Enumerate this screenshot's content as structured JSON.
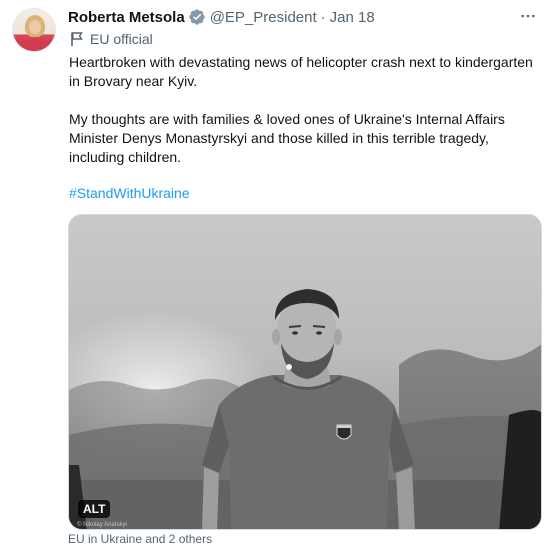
{
  "tweet": {
    "author_name": "Roberta Metsola",
    "handle": "@EP_President",
    "separator": "·",
    "date": "Jan 18",
    "more_label": "···",
    "affiliation": "EU official",
    "paragraphs": [
      "Heartbroken with devastating news of helicopter crash next to kindergarten in Brovary near Kyiv.",
      "My thoughts are with families & loved ones of Ukraine's Internal Affairs Minister Denys Monastyrskyi and those killed in this terrible tragedy, including children."
    ],
    "hashtag": "#StandWithUkraine",
    "media": {
      "alt_label": "ALT",
      "photo_credit": "© Nikolay Anatskyi"
    },
    "tagged": "EU in Ukraine and 2 others"
  },
  "colors": {
    "text": "#0f1419",
    "secondary": "#536471",
    "link": "#1d9bf0",
    "verified": "#829aab"
  },
  "icons": {
    "verified": "verified-badge-icon",
    "more": "more-options-icon",
    "affiliation": "flag-icon"
  }
}
